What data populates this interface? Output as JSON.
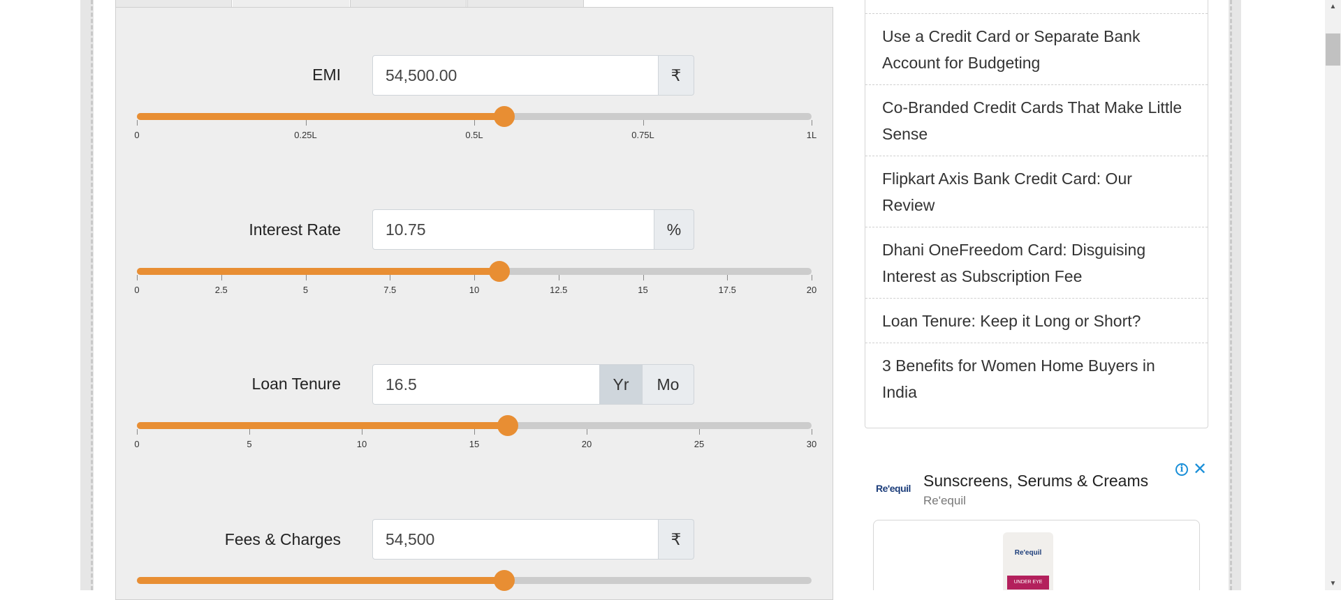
{
  "calculator": {
    "emi": {
      "label": "EMI",
      "value": "54,500.00",
      "unit": "₹",
      "slider_fraction": 0.545,
      "ticks": [
        "0",
        "0.25L",
        "0.5L",
        "0.75L",
        "1L"
      ]
    },
    "interest_rate": {
      "label": "Interest Rate",
      "value": "10.75",
      "unit": "%",
      "slider_fraction": 0.5375,
      "ticks": [
        "0",
        "2.5",
        "5",
        "7.5",
        "10",
        "12.5",
        "15",
        "17.5",
        "20"
      ]
    },
    "loan_tenure": {
      "label": "Loan Tenure",
      "value": "16.5",
      "unit_year": "Yr",
      "unit_month": "Mo",
      "selected_unit": "Yr",
      "slider_fraction": 0.55,
      "ticks": [
        "0",
        "5",
        "10",
        "15",
        "20",
        "25",
        "30"
      ]
    },
    "fees_charges": {
      "label": "Fees & Charges",
      "value": "54,500",
      "unit": "₹",
      "slider_fraction": 0.545
    }
  },
  "sidebar": {
    "items": [
      {
        "lines": [
          "Use a Credit Card or Separate Bank",
          "Account for Budgeting"
        ]
      },
      {
        "lines": [
          "Co-Branded Credit Cards That Make Little",
          "Sense"
        ]
      },
      {
        "lines": [
          "Flipkart Axis Bank Credit Card: Our",
          "Review"
        ]
      },
      {
        "lines": [
          "Dhani OneFreedom Card: Disguising",
          "Interest as Subscription Fee"
        ]
      },
      {
        "lines": [
          "Loan Tenure: Keep it Long or Short?"
        ]
      },
      {
        "lines": [
          "3 Benefits for Women Home Buyers in",
          "India"
        ]
      }
    ]
  },
  "ad": {
    "logo": "Re'equil",
    "title": "Sunscreens, Serums & Creams",
    "brand": "Re'equil",
    "info_icon": "info-icon",
    "close_icon": "close-icon",
    "product_label": "Re'equil",
    "product_band": "UNDER EYE"
  },
  "colors": {
    "accent": "#e88e33",
    "panel": "#eeeeee",
    "link": "#1a8fd8"
  }
}
